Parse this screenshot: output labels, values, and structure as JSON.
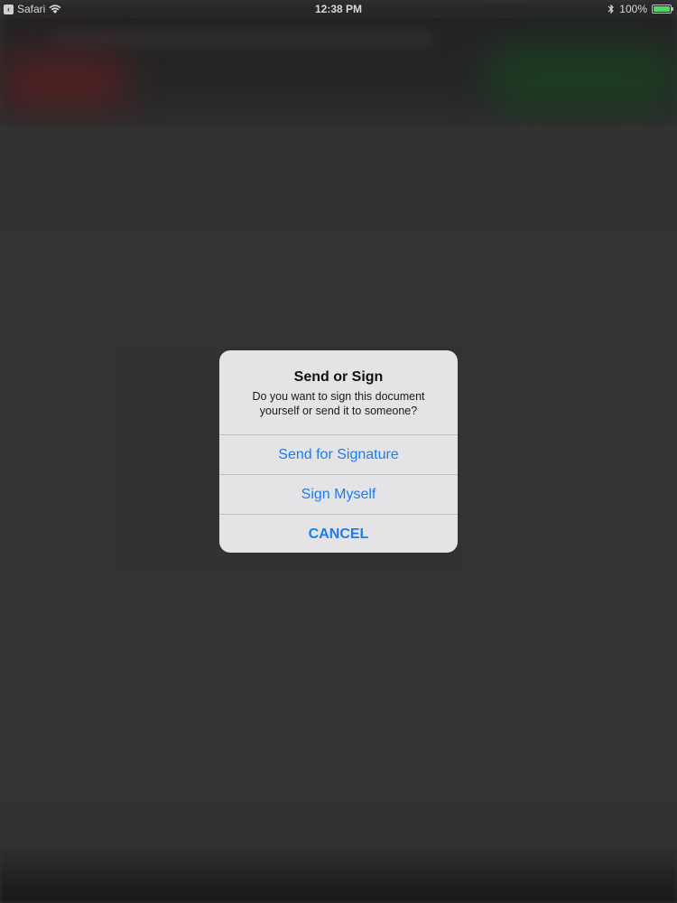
{
  "status_bar": {
    "back_app_label": "Safari",
    "time": "12:38 PM",
    "battery_percent": "100%"
  },
  "alert": {
    "title": "Send or Sign",
    "message": "Do you want to sign this document yourself or send it to someone?",
    "actions": [
      {
        "label": "Send for Signature"
      },
      {
        "label": "Sign Myself"
      },
      {
        "label": "CANCEL"
      }
    ]
  },
  "colors": {
    "action_blue": "#1b7cf2",
    "alert_background": "#e4e4e6",
    "battery_green": "#4cd964"
  },
  "icons": {
    "back_app": "back-app-icon",
    "wifi": "wifi-icon",
    "bluetooth": "bluetooth-icon",
    "battery": "battery-icon"
  }
}
